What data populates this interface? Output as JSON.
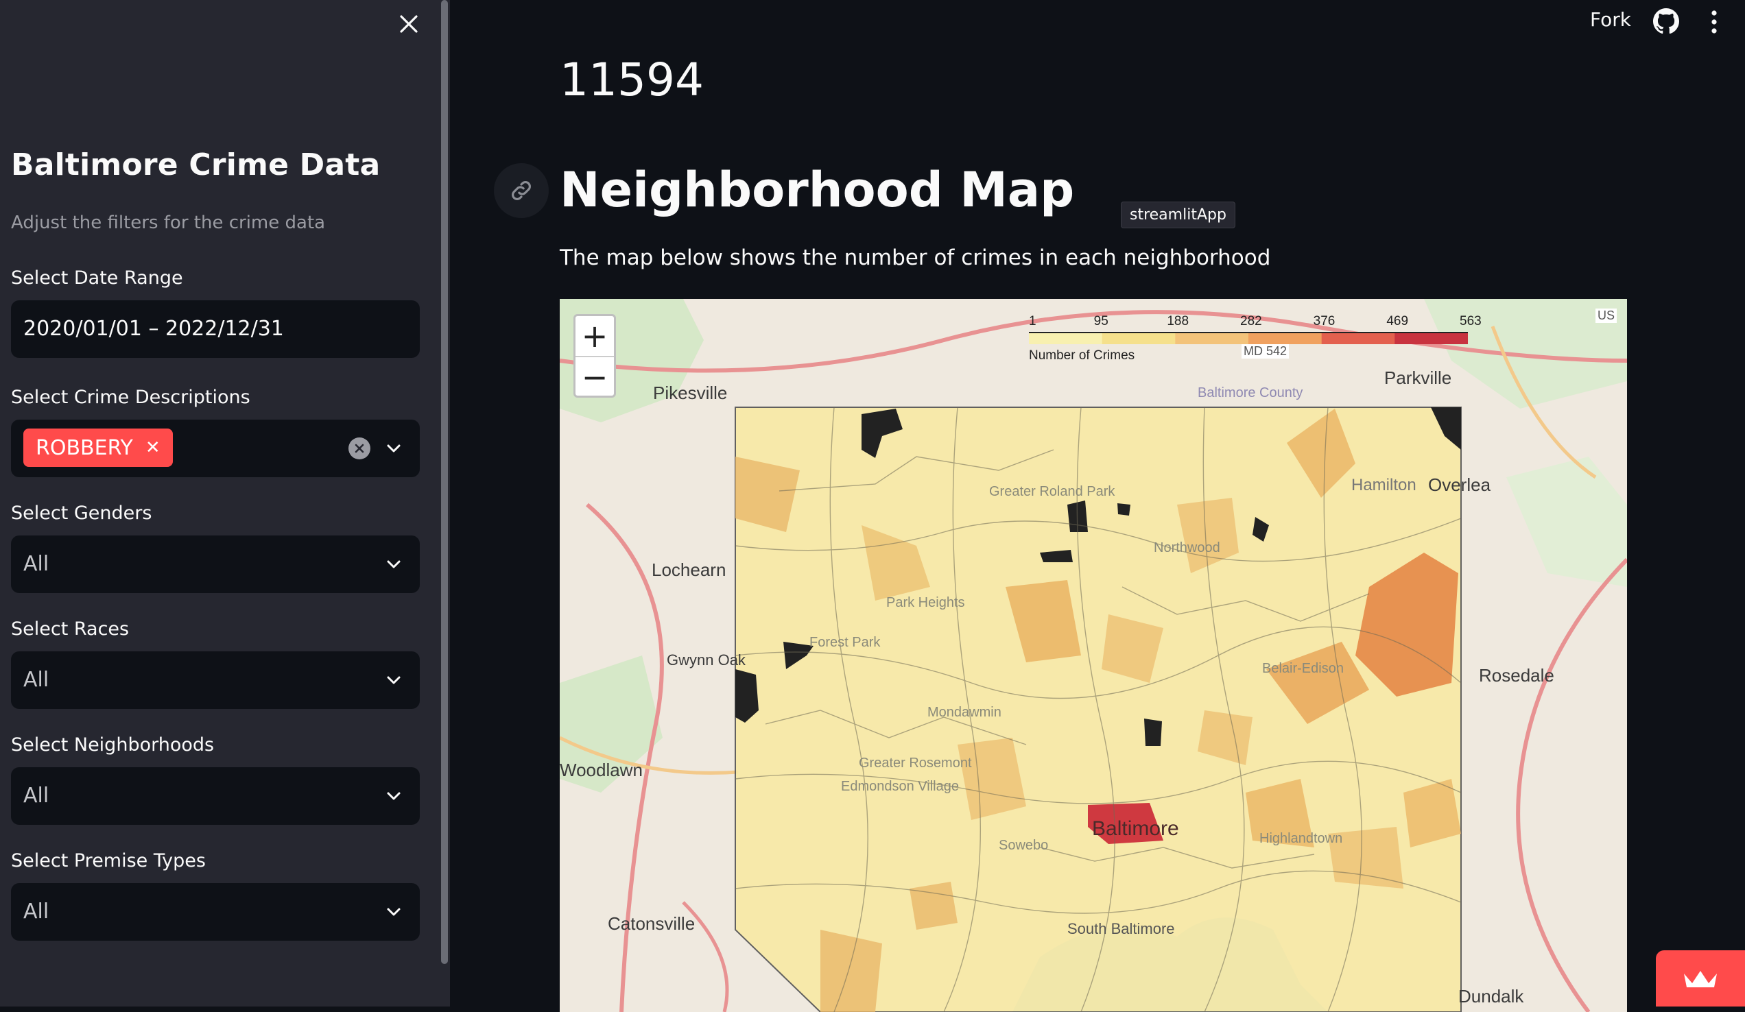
{
  "sidebar": {
    "title": "Baltimore Crime Data",
    "caption": "Adjust the filters for the crime data",
    "date_range": {
      "label": "Select Date Range",
      "value": "2020/01/01 – 2022/12/31"
    },
    "descriptions": {
      "label": "Select Crime Descriptions",
      "tag": "ROBBERY"
    },
    "genders": {
      "label": "Select Genders",
      "value": "All"
    },
    "races": {
      "label": "Select Races",
      "value": "All"
    },
    "neighborhoods": {
      "label": "Select Neighborhoods",
      "value": "All"
    },
    "premise": {
      "label": "Select Premise Types",
      "value": "All"
    }
  },
  "topbar": {
    "fork": "Fork"
  },
  "main": {
    "metric": "11594",
    "heading": "Neighborhood Map",
    "tooltip": "streamlitApp",
    "description": "The map below shows the number of crimes in each neighborhood"
  },
  "map": {
    "legend": {
      "ticks": [
        "1",
        "95",
        "188",
        "282",
        "376",
        "469",
        "563"
      ],
      "caption": "Number of Crimes"
    },
    "labels": {
      "pikesville": "Pikesville",
      "parkville": "Parkville",
      "lochearn": "Lochearn",
      "gwynn_oak": "Gwynn Oak",
      "woodlawn": "Woodlawn",
      "catonsville": "Catonsville",
      "rosedale": "Rosedale",
      "overlea": "Overlea",
      "hamilton": "Hamilton",
      "baltimore": "Baltimore",
      "baltimore_county": "Baltimore County",
      "greater_roland_park": "Greater Roland Park",
      "northwood": "Northwood",
      "park_heights": "Park Heights",
      "forest_park": "Forest Park",
      "mondawmin": "Mondawmin",
      "belair_edison": "Belair-Edison",
      "greater_rosemont": "Greater Rosemont",
      "edmondson_village": "Edmondson Village",
      "highlandtown": "Highlandtown",
      "south_baltimore": "South Baltimore",
      "sowebo": "Sowebo",
      "dundalk": "Dundalk",
      "md542": "MD 542",
      "us": "US"
    }
  },
  "colors": {
    "accent": "#ff4b4b",
    "background": "#0e1117",
    "sidebar": "#262730"
  }
}
